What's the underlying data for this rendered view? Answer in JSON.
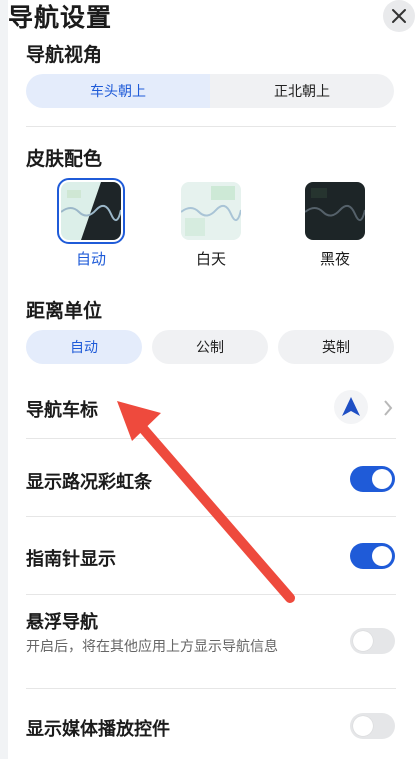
{
  "header": {
    "title": "导航设置",
    "close_icon": "close-icon"
  },
  "view_angle": {
    "title": "导航视角",
    "options": [
      "车头朝上",
      "正北朝上"
    ],
    "selected": "车头朝上"
  },
  "skin": {
    "title": "皮肤配色",
    "options": [
      "自动",
      "白天",
      "黑夜"
    ],
    "selected": "自动"
  },
  "distance_unit": {
    "title": "距离单位",
    "options": [
      "自动",
      "公制",
      "英制"
    ],
    "selected": "自动"
  },
  "nav_marker": {
    "label": "导航车标",
    "icon": "navigation-arrow-icon"
  },
  "traffic_bar": {
    "label": "显示路况彩虹条",
    "enabled": true
  },
  "compass": {
    "label": "指南针显示",
    "enabled": true
  },
  "floating_nav": {
    "label": "悬浮导航",
    "description": "开启后，将在其他应用上方显示导航信息",
    "enabled": false
  },
  "media_controls": {
    "label": "显示媒体播放控件",
    "enabled": false
  },
  "colors": {
    "accent": "#1f5bd8",
    "annotation_arrow": "#ee4a3d"
  }
}
